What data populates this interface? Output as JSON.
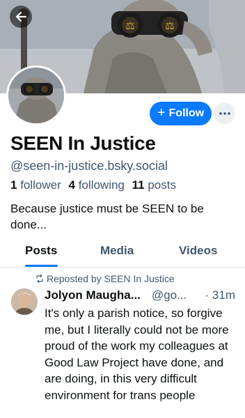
{
  "profile": {
    "display_name": "SEEN In Justice",
    "handle": "@seen-in-justice.bsky.social",
    "followers_count": "1",
    "followers_label": "follower",
    "following_count": "4",
    "following_label": "following",
    "posts_count": "11",
    "posts_label": "posts",
    "bio": "Because justice must be SEEN to be done..."
  },
  "actions": {
    "follow_label": "Follow"
  },
  "tabs": [
    {
      "label": "Posts",
      "active": true
    },
    {
      "label": "Media",
      "active": false
    },
    {
      "label": "Videos",
      "active": false
    }
  ],
  "feed": [
    {
      "repost_label": "Reposted by SEEN In Justice",
      "author": "Jolyon Maugha...",
      "handle": "@go...",
      "time": "· 31m",
      "text": "It's only a parish notice, so forgive me, but I literally could not be more proud of the work my colleagues at Good Law Project have done, and are doing, in this very difficult environment for trans people"
    }
  ],
  "colors": {
    "accent": "#0a7aff",
    "text_primary": "#0b0f14",
    "text_secondary": "#42576c",
    "divider": "#dfe3e8"
  },
  "icons": {
    "back": "arrow-left-icon",
    "follow": "plus-icon",
    "more": "ellipsis-icon",
    "repost": "repost-icon"
  }
}
